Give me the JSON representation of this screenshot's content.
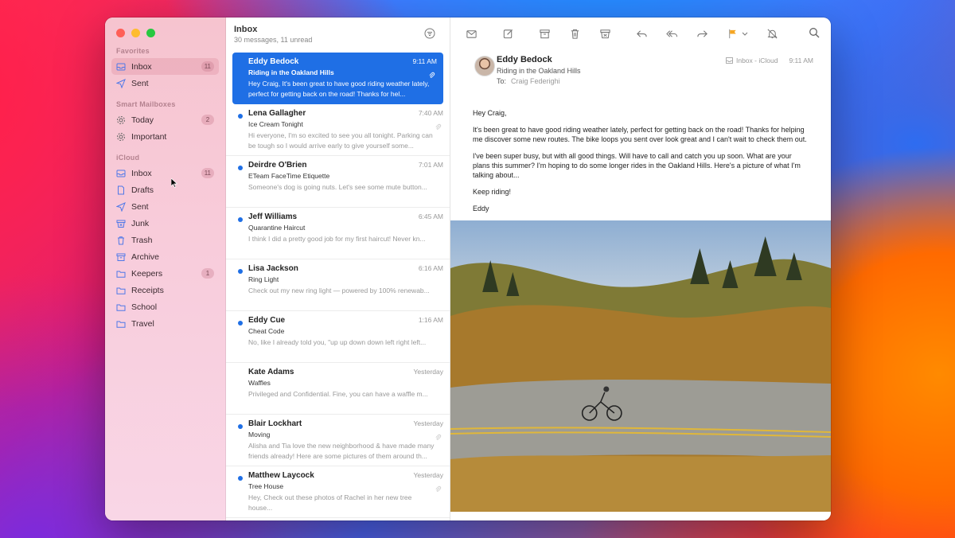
{
  "window": {
    "list_title": "Inbox",
    "list_subtitle": "30 messages, 11 unread"
  },
  "sidebar": {
    "sections": [
      {
        "title": "Favorites",
        "items": [
          {
            "label": "Inbox",
            "icon": "inbox-icon",
            "badge": "11",
            "active": true
          },
          {
            "label": "Sent",
            "icon": "paperplane-icon",
            "badge": ""
          }
        ]
      },
      {
        "title": "Smart Mailboxes",
        "items": [
          {
            "label": "Today",
            "icon": "gear-icon",
            "badge": "2"
          },
          {
            "label": "Important",
            "icon": "gear-icon",
            "badge": ""
          }
        ]
      },
      {
        "title": "iCloud",
        "items": [
          {
            "label": "Inbox",
            "icon": "inbox-icon",
            "badge": "11"
          },
          {
            "label": "Drafts",
            "icon": "document-icon",
            "badge": ""
          },
          {
            "label": "Sent",
            "icon": "paperplane-icon",
            "badge": ""
          },
          {
            "label": "Junk",
            "icon": "junk-icon",
            "badge": ""
          },
          {
            "label": "Trash",
            "icon": "trash-icon",
            "badge": ""
          },
          {
            "label": "Archive",
            "icon": "archive-icon",
            "badge": ""
          },
          {
            "label": "Keepers",
            "icon": "folder-icon",
            "badge": "1"
          },
          {
            "label": "Receipts",
            "icon": "folder-icon",
            "badge": ""
          },
          {
            "label": "School",
            "icon": "folder-icon",
            "badge": ""
          },
          {
            "label": "Travel",
            "icon": "folder-icon",
            "badge": ""
          }
        ]
      }
    ]
  },
  "messages": [
    {
      "sender": "Eddy Bedock",
      "time": "9:11 AM",
      "subject": "Riding in the Oakland Hills",
      "preview": "Hey Craig, It's been great to have good riding weather lately, perfect for getting back on the road! Thanks for hel...",
      "unread": false,
      "selected": true,
      "attachment": true
    },
    {
      "sender": "Lena Gallagher",
      "time": "7:40 AM",
      "subject": "Ice Cream Tonight",
      "preview": "Hi everyone, I'm so excited to see you all tonight. Parking can be tough so I would arrive early to give yourself some...",
      "unread": true,
      "selected": false,
      "attachment": true
    },
    {
      "sender": "Deirdre O'Brien",
      "time": "7:01 AM",
      "subject": "ETeam FaceTime Etiquette",
      "preview": "Someone's dog is going nuts. Let's see some mute button...",
      "unread": true,
      "selected": false,
      "attachment": false
    },
    {
      "sender": "Jeff Williams",
      "time": "6:45 AM",
      "subject": "Quarantine Haircut",
      "preview": "I think I did a pretty good job for my first haircut! Never kn...",
      "unread": true,
      "selected": false,
      "attachment": false
    },
    {
      "sender": "Lisa Jackson",
      "time": "6:16 AM",
      "subject": "Ring Light",
      "preview": "Check out my new ring light — powered by 100% renewab...",
      "unread": true,
      "selected": false,
      "attachment": false
    },
    {
      "sender": "Eddy Cue",
      "time": "1:16 AM",
      "subject": "Cheat Code",
      "preview": "No, like I already told you, \"up up down down left right left...",
      "unread": true,
      "selected": false,
      "attachment": false
    },
    {
      "sender": "Kate Adams",
      "time": "Yesterday",
      "subject": "Waffles",
      "preview": "Privileged and Confidential. Fine, you can have a waffle m...",
      "unread": false,
      "selected": false,
      "attachment": false
    },
    {
      "sender": "Blair Lockhart",
      "time": "Yesterday",
      "subject": "Moving",
      "preview": "Alisha and Tia love the new neighborhood & have made many friends already! Here are some pictures of them around th...",
      "unread": true,
      "selected": false,
      "attachment": true
    },
    {
      "sender": "Matthew Laycock",
      "time": "Yesterday",
      "subject": "Tree House",
      "preview": "Hey, Check out these photos of Rachel in her new tree house...",
      "unread": true,
      "selected": false,
      "attachment": true
    }
  ],
  "reader": {
    "from": "Eddy Bedock",
    "subject": "Riding in the Oakland Hills",
    "to_label": "To:",
    "to_name": "Craig Federighi",
    "mailbox": "Inbox - iCloud",
    "time": "9:11 AM",
    "body": [
      "Hey Craig,",
      "It's been great to have good riding weather lately, perfect for getting back on the road! Thanks for helping me discover some new routes. The bike loops you sent over look great and I can't wait to check them out.",
      "I've been super busy, but with all good things. Will have to call and catch you up soon. What are your plans this summer? I'm hoping to do some longer rides in the Oakland Hills. Here's a picture of what I'm talking about...",
      "Keep riding!",
      "Eddy"
    ]
  },
  "colors": {
    "accent": "#1f6fe5",
    "flag": "#f5a623"
  }
}
